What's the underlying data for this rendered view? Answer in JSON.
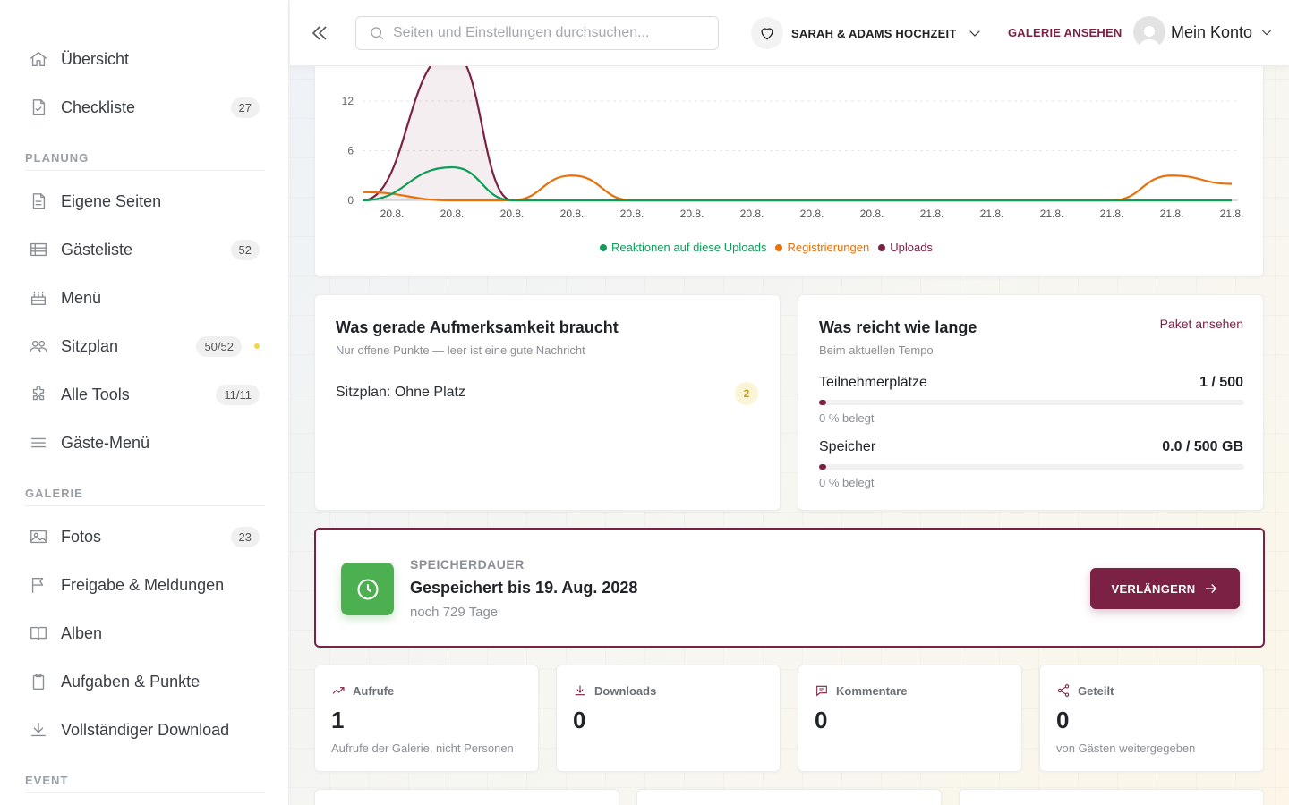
{
  "sidebar": {
    "items_top": [
      {
        "label": "Übersicht",
        "icon": "home-icon",
        "badge": ""
      },
      {
        "label": "Checkliste",
        "icon": "checklist-icon",
        "badge": "27"
      }
    ],
    "sections": [
      {
        "title": "PLANUNG",
        "items": [
          {
            "label": "Eigene Seiten",
            "icon": "page-icon",
            "badge": ""
          },
          {
            "label": "Gästeliste",
            "icon": "table-icon",
            "badge": "52"
          },
          {
            "label": "Menü",
            "icon": "cake-icon",
            "badge": ""
          },
          {
            "label": "Sitzplan",
            "icon": "users-icon",
            "badge": "50/52"
          },
          {
            "label": "Alle Tools",
            "icon": "puzzle-icon",
            "badge": "11/11"
          },
          {
            "label": "Gäste-Menü",
            "icon": "menu-icon",
            "badge": ""
          }
        ]
      },
      {
        "title": "GALERIE",
        "items": [
          {
            "label": "Fotos",
            "icon": "image-icon",
            "badge": "23"
          },
          {
            "label": "Freigabe & Meldungen",
            "icon": "flag-icon",
            "badge": ""
          },
          {
            "label": "Alben",
            "icon": "book-icon",
            "badge": ""
          },
          {
            "label": "Aufgaben & Punkte",
            "icon": "clipboard-icon",
            "badge": ""
          },
          {
            "label": "Vollständiger Download",
            "icon": "download-icon",
            "badge": ""
          }
        ]
      },
      {
        "title": "EVENT",
        "items": []
      }
    ]
  },
  "topbar": {
    "search_placeholder": "Seiten und Einstellungen durchsuchen...",
    "event_name": "SARAH & ADAMS HOCHZEIT",
    "gallery_link": "GALERIE ANSEHEN",
    "account_label": "Mein Konto"
  },
  "chart_data": {
    "type": "line",
    "title": "",
    "xlabel": "",
    "ylabel": "",
    "ylim": [
      0,
      12
    ],
    "yticks": [
      0,
      6,
      12
    ],
    "x": [
      "20.8.",
      "20.8.",
      "20.8.",
      "20.8.",
      "20.8.",
      "20.8.",
      "20.8.",
      "20.8.",
      "20.8.",
      "21.8.",
      "21.8.",
      "21.8.",
      "21.8.",
      "21.8.",
      "21.8."
    ],
    "series": [
      {
        "name": "Reaktionen auf diese Uploads",
        "color": "#0f9d58",
        "values": [
          0,
          4,
          0,
          0,
          0,
          0,
          0,
          0,
          0,
          0,
          0,
          0,
          0,
          0,
          0
        ]
      },
      {
        "name": "Registrierungen",
        "color": "#e8710a",
        "values": [
          1,
          0,
          0,
          3,
          0,
          0,
          0,
          0,
          0,
          0,
          0,
          0,
          0,
          3,
          2
        ]
      },
      {
        "name": "Uploads",
        "color": "#7b2244",
        "values": [
          0,
          18,
          0,
          0,
          0,
          0,
          0,
          0,
          0,
          0,
          0,
          0,
          0,
          0,
          0
        ]
      }
    ],
    "legend_placement": "bottom-center",
    "grid": true
  },
  "attention": {
    "title": "Was gerade Aufmerksamkeit braucht",
    "subtitle": "Nur offene Punkte — leer ist eine gute Nachricht",
    "item_label": "Sitzplan: Ohne Platz",
    "item_count": "2"
  },
  "usage": {
    "title": "Was reicht wie lange",
    "subtitle": "Beim aktuellen Tempo",
    "link": "Paket ansehen",
    "rows": [
      {
        "label": "Teilnehmerplätze",
        "value": "1 / 500",
        "note": "0 % belegt",
        "fraction": 0.002
      },
      {
        "label": "Speicher",
        "value": "0.0 / 500 GB",
        "note": "0 % belegt",
        "fraction": 0.0
      }
    ]
  },
  "storage": {
    "kicker": "SPEICHERDAUER",
    "title": "Gespeichert bis 19. Aug. 2028",
    "sub": "noch 729 Tage",
    "button": "VERLÄNGERN"
  },
  "stats": [
    {
      "label": "Aufrufe",
      "icon": "trend-icon",
      "value": "1",
      "note": "Aufrufe der Galerie, nicht Personen"
    },
    {
      "label": "Downloads",
      "icon": "download-icon",
      "value": "0",
      "note": ""
    },
    {
      "label": "Kommentare",
      "icon": "comment-icon",
      "value": "0",
      "note": ""
    },
    {
      "label": "Geteilt",
      "icon": "share-icon",
      "value": "0",
      "note": "von Gästen weitergegeben"
    }
  ],
  "colors": {
    "brand": "#7b2244",
    "accent_green": "#4caf50",
    "badge_yellow": "#f1d64a"
  }
}
